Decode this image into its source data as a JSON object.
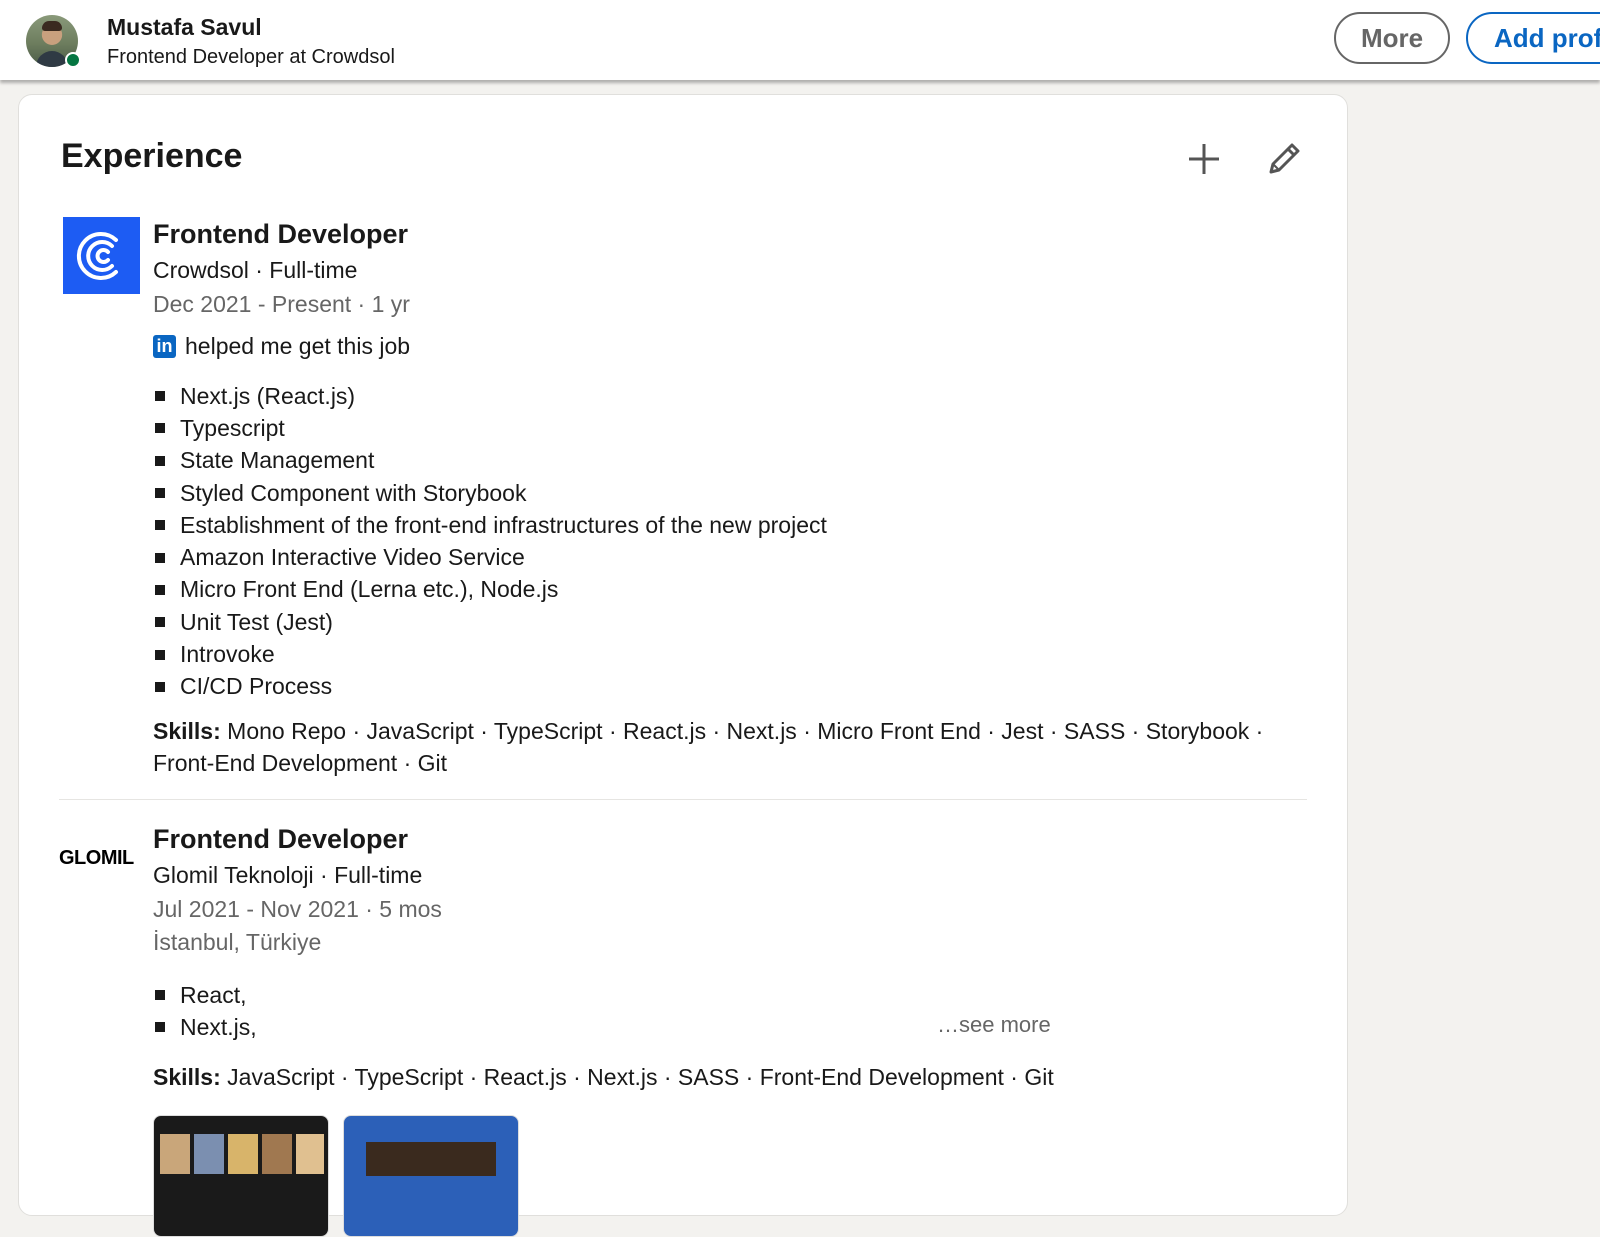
{
  "topbar": {
    "name": "Mustafa Savul",
    "headline": "Frontend Developer at Crowdsol",
    "more_label": "More",
    "add_label": "Add profile section",
    "online_color": "#057642"
  },
  "experience": {
    "title": "Experience",
    "add_icon": "plus-icon",
    "edit_icon": "pencil-icon",
    "jobs": [
      {
        "title": "Frontend Developer",
        "company_line": "Crowdsol · Full-time",
        "dates": "Dec 2021 - Present · 1 yr",
        "helped": "helped me get this job",
        "in_logo": "in",
        "logo_color": "#1d5cf3",
        "bullets": [
          "Next.js (React.js)",
          "Typescript",
          "State Management",
          "Styled Component with Storybook",
          "Establishment of the front-end infrastructures of the new project",
          "Amazon Interactive Video Service",
          "Micro Front End (Lerna etc.), Node.js",
          "Unit Test (Jest)",
          "Introvoke",
          "CI/CD Process"
        ],
        "skills_label": "Skills:",
        "skills": " Mono Repo · JavaScript · TypeScript · React.js · Next.js · Micro Front End · Jest · SASS · Storybook · Front-End Development · Git"
      },
      {
        "title": "Frontend Developer",
        "logo_text": "GLOMIL",
        "company_line": "Glomil Teknoloji · Full-time",
        "dates": "Jul 2021 - Nov 2021 · 5 mos",
        "location": "İstanbul, Türkiye",
        "bullets": [
          "React,",
          "Next.js,"
        ],
        "see_more": "…see more",
        "skills_label": "Skills:",
        "skills": " JavaScript · TypeScript · React.js · Next.js · SASS · Front-End Development · Git"
      }
    ]
  }
}
